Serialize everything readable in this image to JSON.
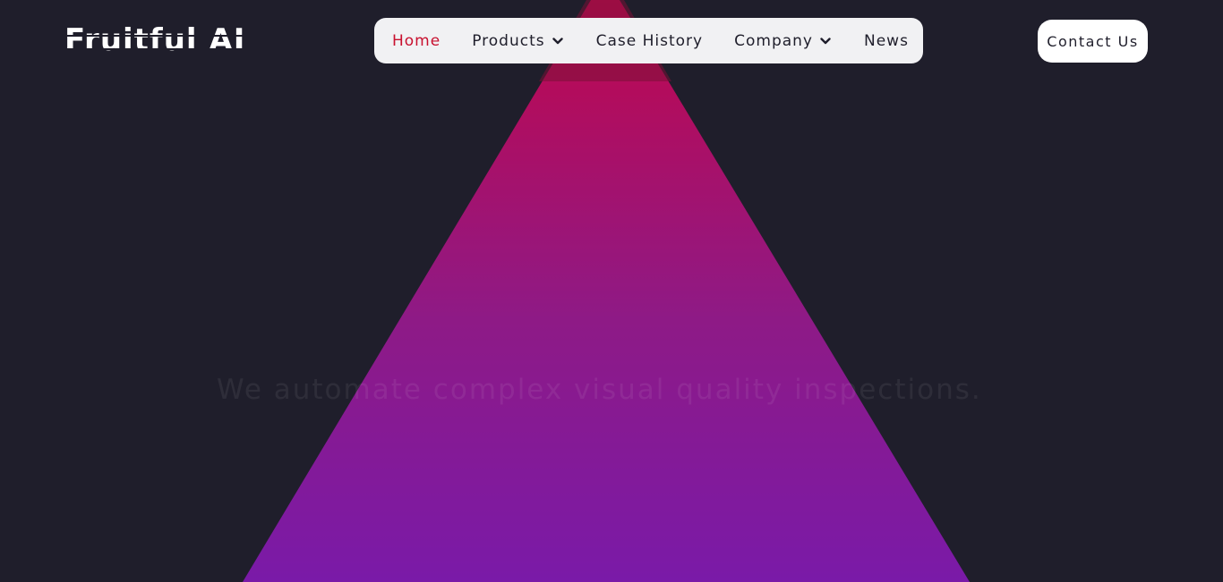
{
  "brand": {
    "logo_text": "Fruitful AI"
  },
  "nav": {
    "items": [
      {
        "label": "Home",
        "active": true
      },
      {
        "label": "Products",
        "has_dropdown": true
      },
      {
        "label": "Case History"
      },
      {
        "label": "Company",
        "has_dropdown": true
      },
      {
        "label": "News"
      }
    ]
  },
  "header": {
    "contact_label": "Contact Us"
  },
  "hero": {
    "tagline": "We automate complex visual quality inspections."
  },
  "colors": {
    "background": "#1f1e2b",
    "accent": "#c8102e",
    "beam_top": "#b30c5c",
    "beam_bottom": "#7a1aa8",
    "nav_background": "#f1f1f3"
  },
  "icons": {
    "dropdown": "chevron-down-icon"
  }
}
